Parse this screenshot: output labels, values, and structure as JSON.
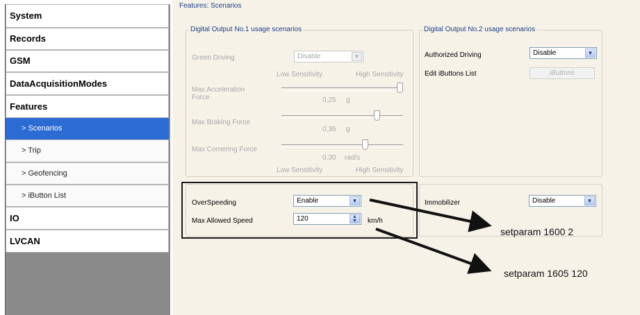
{
  "sidebar": {
    "items": [
      {
        "label": "System",
        "level": "top",
        "active": false
      },
      {
        "label": "Records",
        "level": "top",
        "active": false
      },
      {
        "label": "GSM",
        "level": "top",
        "active": false
      },
      {
        "label": "DataAcquisitionModes",
        "level": "top",
        "active": false
      },
      {
        "label": "Features",
        "level": "top",
        "active": false
      },
      {
        "label": "> Scenarios",
        "level": "sub",
        "active": true
      },
      {
        "label": "> Trip",
        "level": "sub",
        "active": false
      },
      {
        "label": "> Geofencing",
        "level": "sub",
        "active": false
      },
      {
        "label": "> iButton List",
        "level": "sub",
        "active": false
      },
      {
        "label": "IO",
        "level": "top",
        "active": false
      },
      {
        "label": "LVCAN",
        "level": "top",
        "active": false
      }
    ]
  },
  "main": {
    "section_title": "Features: Scenarios",
    "do1": {
      "title": "Digital Output No.1 usage scenarios",
      "green_driving_label": "Green Driving",
      "green_driving_value": "Disable",
      "low_sensitivity": "Low Sensitivity",
      "high_sensitivity": "High Sensitivity",
      "max_accel_label": "Max Acceleration\nForce",
      "max_accel_value": "0,25",
      "max_accel_unit": "g",
      "max_accel_level": 1.0,
      "max_braking_label": "Max Braking Force",
      "max_braking_value": "0,35",
      "max_braking_unit": "g",
      "max_braking_level": 0.8,
      "max_cornering_label": "Max Cornering Force",
      "max_cornering_value": "0,30",
      "max_cornering_unit": "rad/s",
      "max_cornering_level": 0.7
    },
    "do2": {
      "title": "Digital Output No.2 usage scenarios",
      "authorized_driving_label": "Authorized Driving",
      "authorized_driving_value": "Disable",
      "edit_ibuttons_label": "Edit iButtons List",
      "ibuttons_button": "iButtons"
    },
    "overspeeding_label": "OverSpeeding",
    "overspeeding_value": "Enable",
    "max_speed_label": "Max Allowed Speed",
    "max_speed_value": "120",
    "max_speed_unit": "km/h",
    "immobilizer_label": "Immobilizer",
    "immobilizer_value": "Disable"
  },
  "annotations": {
    "a1": "setparam 1600  2",
    "a2": "setparam 1605 120"
  },
  "colors": {
    "active": "#2c6bd4",
    "panel": "#f6f2e8",
    "legend": "#1a3e8a"
  }
}
